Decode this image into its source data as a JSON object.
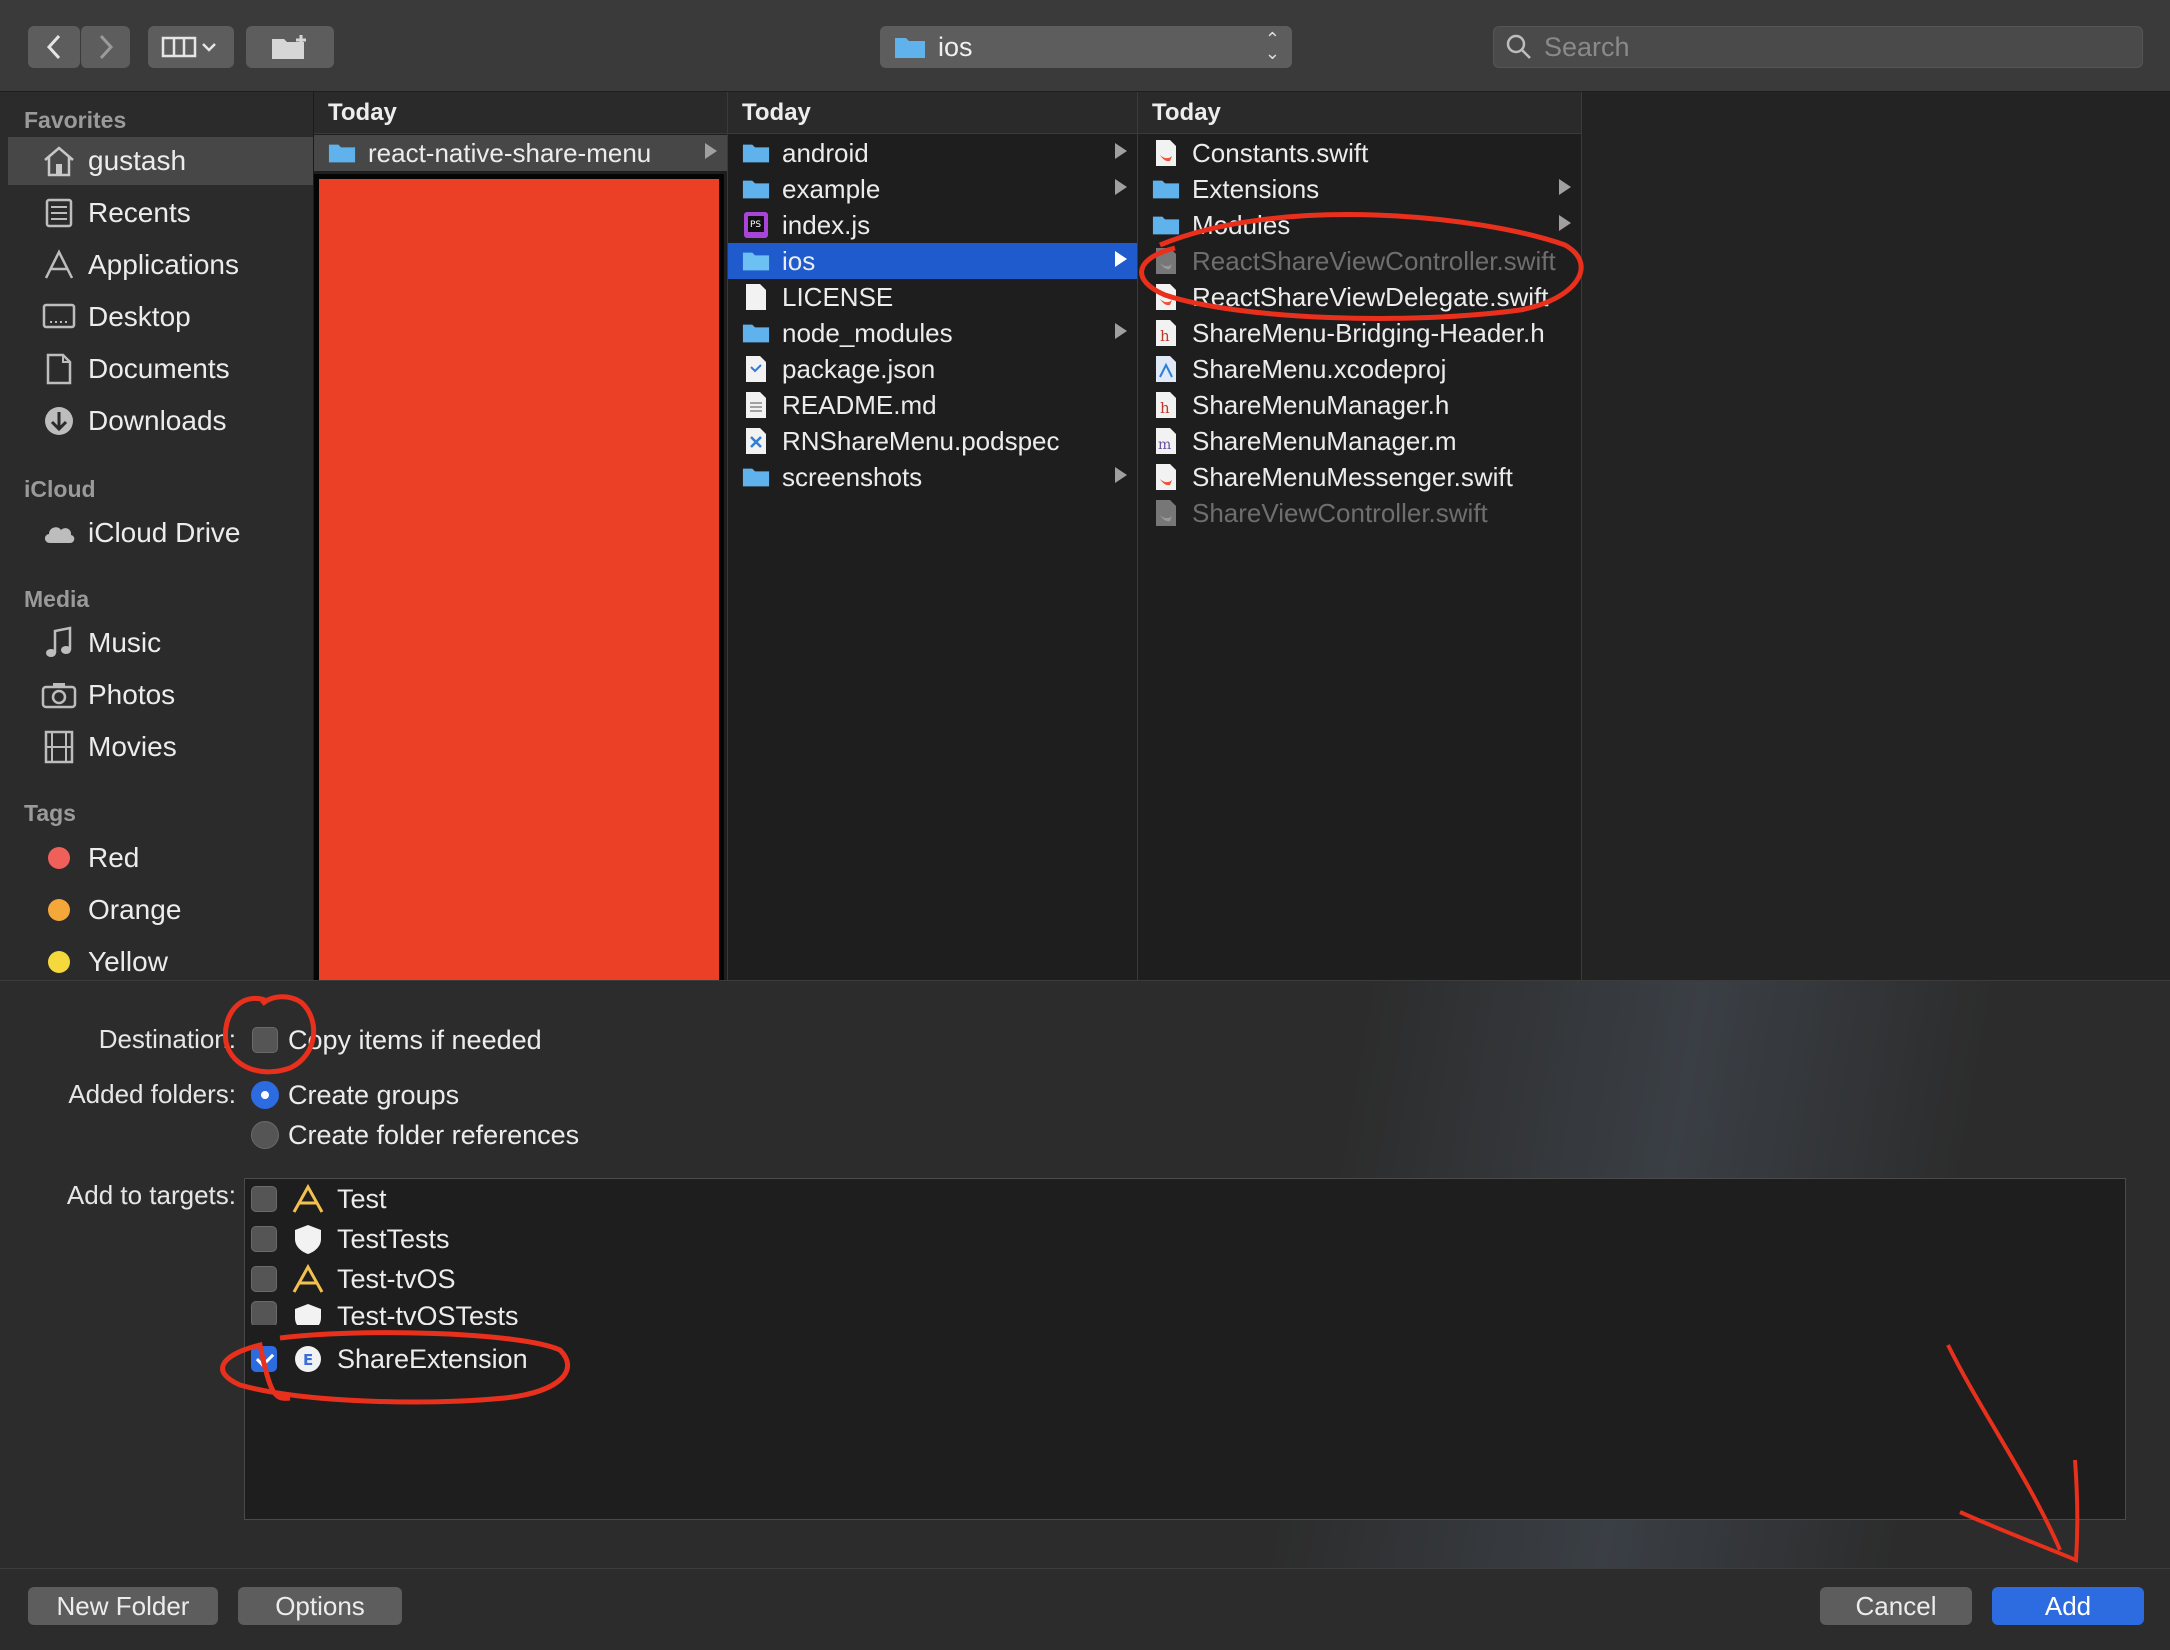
{
  "toolbar": {
    "path_label": "ios",
    "search_placeholder": "Search"
  },
  "sidebar": {
    "sections": [
      {
        "title": "Favorites"
      },
      {
        "title": "iCloud"
      },
      {
        "title": "Media"
      },
      {
        "title": "Tags"
      }
    ],
    "favorites": [
      {
        "label": "gustash",
        "icon": "home-icon"
      },
      {
        "label": "Recents",
        "icon": "recents-icon"
      },
      {
        "label": "Applications",
        "icon": "applications-icon"
      },
      {
        "label": "Desktop",
        "icon": "desktop-icon"
      },
      {
        "label": "Documents",
        "icon": "documents-icon"
      },
      {
        "label": "Downloads",
        "icon": "downloads-icon"
      }
    ],
    "icloud": [
      {
        "label": "iCloud Drive",
        "icon": "cloud-icon"
      }
    ],
    "media": [
      {
        "label": "Music",
        "icon": "music-icon"
      },
      {
        "label": "Photos",
        "icon": "camera-icon"
      },
      {
        "label": "Movies",
        "icon": "film-icon"
      }
    ],
    "tags": [
      {
        "label": "Red",
        "color": "#f0605a"
      },
      {
        "label": "Orange",
        "color": "#f5a73a"
      },
      {
        "label": "Yellow",
        "color": "#f5d83c"
      }
    ]
  },
  "columns": [
    {
      "header": "Today",
      "items": [
        {
          "name": "react-native-share-menu",
          "kind": "folder",
          "expand": true
        }
      ]
    },
    {
      "header": "Today",
      "items": [
        {
          "name": "android",
          "kind": "folder",
          "expand": true
        },
        {
          "name": "example",
          "kind": "folder",
          "expand": true
        },
        {
          "name": "index.js",
          "kind": "js"
        },
        {
          "name": "ios",
          "kind": "folder",
          "expand": true
        },
        {
          "name": "LICENSE",
          "kind": "doc"
        },
        {
          "name": "node_modules",
          "kind": "folder",
          "expand": true
        },
        {
          "name": "package.json",
          "kind": "json"
        },
        {
          "name": "README.md",
          "kind": "doc"
        },
        {
          "name": "RNShareMenu.podspec",
          "kind": "code"
        },
        {
          "name": "screenshots",
          "kind": "folder",
          "expand": true
        }
      ]
    },
    {
      "header": "Today",
      "items": [
        {
          "name": "Constants.swift",
          "kind": "swift"
        },
        {
          "name": "Extensions",
          "kind": "folder",
          "expand": true
        },
        {
          "name": "Modules",
          "kind": "folder",
          "expand": true
        },
        {
          "name": "ReactShareViewController.swift",
          "kind": "swift",
          "dim": true
        },
        {
          "name": "ReactShareViewDelegate.swift",
          "kind": "swift"
        },
        {
          "name": "ShareMenu-Bridging-Header.h",
          "kind": "header"
        },
        {
          "name": "ShareMenu.xcodeproj",
          "kind": "xcodeproj"
        },
        {
          "name": "ShareMenuManager.h",
          "kind": "header"
        },
        {
          "name": "ShareMenuManager.m",
          "kind": "objc"
        },
        {
          "name": "ShareMenuMessenger.swift",
          "kind": "swift"
        },
        {
          "name": "ShareViewController.swift",
          "kind": "swift",
          "dim": true
        }
      ]
    }
  ],
  "options": {
    "destination_label": "Destination:",
    "copy_items_label": "Copy items if needed",
    "copy_items_checked": false,
    "added_folders_label": "Added folders:",
    "create_groups_label": "Create groups",
    "create_folder_refs_label": "Create folder references",
    "selected_folder_option": "Create groups",
    "add_to_targets_label": "Add to targets:",
    "targets": [
      {
        "name": "Test",
        "icon": "app-target-icon",
        "checked": false
      },
      {
        "name": "TestTests",
        "icon": "test-target-icon",
        "checked": false
      },
      {
        "name": "Test-tvOS",
        "icon": "app-target-icon",
        "checked": false
      },
      {
        "name": "Test-tvOSTests",
        "icon": "test-target-icon",
        "checked": false
      },
      {
        "name": "ShareExtension",
        "icon": "extension-target-icon",
        "checked": true
      }
    ]
  },
  "footer": {
    "new_folder_label": "New Folder",
    "options_label": "Options",
    "cancel_label": "Cancel",
    "add_label": "Add"
  },
  "colors": {
    "accent": "#2c6be0",
    "selection": "#1f5bcc",
    "annotation": "#e8301c",
    "redaction": "#eb4026"
  }
}
